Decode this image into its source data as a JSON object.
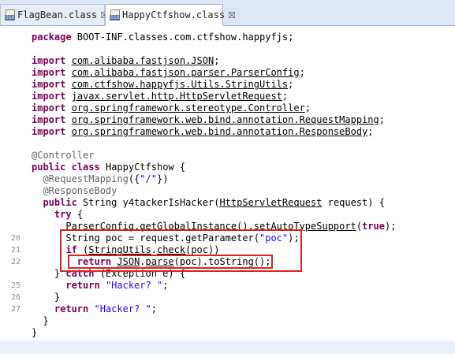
{
  "tabs": [
    {
      "label": "FlagBean.class",
      "close": "☒",
      "icon": "class-file-icon"
    },
    {
      "label": "HappyCtfshow.class",
      "close": "☒",
      "icon": "class-file-icon"
    }
  ],
  "gutter": {
    "lines": [
      "20",
      "21",
      "22",
      "25",
      "26",
      "27"
    ]
  },
  "code": {
    "package_kw": "package",
    "package_name": " BOOT-INF.classes.com.ctfshow.happyfjs;",
    "import_kw": "import",
    "imports": [
      "com.alibaba.fastjson.JSON",
      "com.alibaba.fastjson.parser.ParserConfig",
      "com.ctfshow.happyfjs.Utils.StringUtils",
      "javax.servlet.http.HttpServletRequest",
      "org.springframework.stereotype.Controller",
      "org.springframework.web.bind.annotation.RequestMapping",
      "org.springframework.web.bind.annotation.ResponseBody"
    ],
    "semicolon": ";",
    "annotation_controller": "@Controller",
    "public_kw": "public",
    "class_kw": "class",
    "class_name": " HappyCtfshow {",
    "request_mapping": "@RequestMapping",
    "request_mapping_args_open": "({",
    "request_mapping_value": "\"/\"",
    "request_mapping_args_close": "})",
    "response_body": "@ResponseBody",
    "method_sig_pre": " String y4tackerIsHacker(",
    "method_param_type": "HttpServletRequest",
    "method_sig_post": " request) {",
    "try_kw": "try",
    "try_brace": " {",
    "parser_config": "ParserConfig",
    "get_global": ".getGlobalInstance()",
    "set_auto": ".setAutoTypeSupport",
    "paren_open": "(",
    "true_kw": "true",
    "paren_close_semi": ");",
    "poc_decl_pre": "String poc = request.getParameter(",
    "poc_str": "\"poc\"",
    "if_kw": "if",
    "if_open": " (",
    "string_utils": "StringUtils",
    "dot": ".",
    "check": "check",
    "if_close": "(poc))",
    "return_kw": "return",
    "json": "JSON",
    "parse": "parse",
    "parse_rest": "(poc).toString();",
    "catch_pre": "} ",
    "catch_kw": "catch",
    "catch_rest": " (Exception e) {",
    "hacker_str": "\"Hacker? \"",
    "close_brace": "}",
    "close_brace_indent2": "}"
  },
  "highlight_color": "#e02020"
}
